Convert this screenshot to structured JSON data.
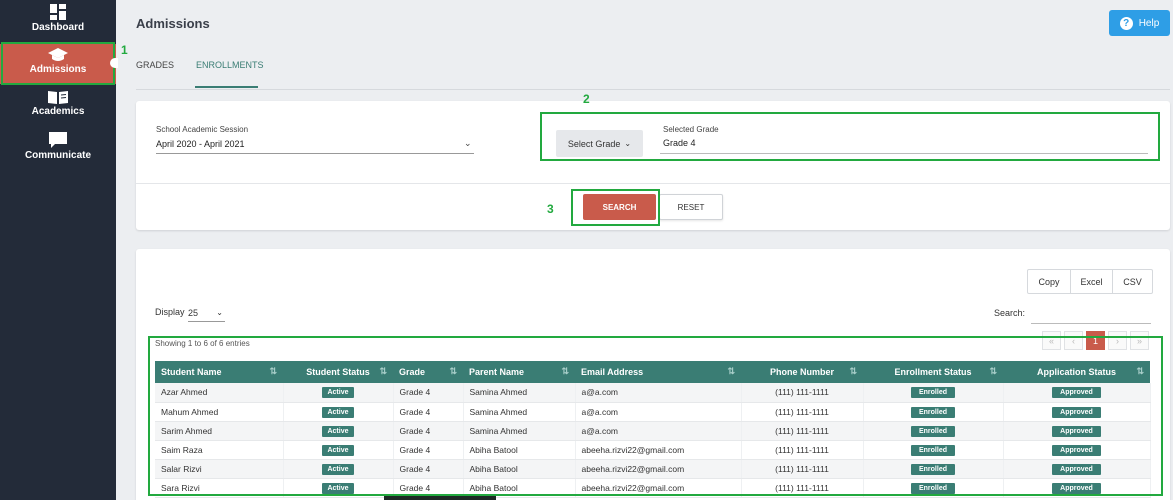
{
  "sidebar": {
    "items": [
      {
        "label": "Dashboard",
        "icon": "dashboard-icon"
      },
      {
        "label": "Admissions",
        "icon": "graduation-cap-icon"
      },
      {
        "label": "Academics",
        "icon": "book-icon"
      },
      {
        "label": "Communicate",
        "icon": "chat-bubble-icon"
      }
    ]
  },
  "annotations": {
    "a1": "1",
    "a2": "2",
    "a3": "3"
  },
  "header": {
    "title": "Admissions",
    "help_label": "Help"
  },
  "tabs": [
    {
      "label": "GRADES"
    },
    {
      "label": "ENROLLMENTS"
    }
  ],
  "filters": {
    "session_label": "School Academic Session",
    "session_value": "April 2020 - April 2021",
    "select_grade_label": "Select Grade",
    "selected_grade_label": "Selected Grade",
    "selected_grade_value": "Grade 4",
    "search_label": "SEARCH",
    "reset_label": "RESET"
  },
  "table_controls": {
    "export": [
      "Copy",
      "Excel",
      "CSV"
    ],
    "display_label": "Display",
    "display_value": "25",
    "search_label": "Search:",
    "search_value": "",
    "showing": "Showing 1 to 6 of 6 entries",
    "pager": [
      "«",
      "‹",
      "1",
      "›",
      "»"
    ]
  },
  "table": {
    "headers": [
      "Student Name",
      "Student Status",
      "Grade",
      "Parent Name",
      "Email Address",
      "Phone Number",
      "Enrollment Status",
      "Application Status"
    ],
    "rows": [
      [
        "Azar Ahmed",
        "Active",
        "Grade 4",
        "Samina Ahmed",
        "a@a.com",
        "(111) 111-1111",
        "Enrolled",
        "Approved"
      ],
      [
        "Mahum Ahmed",
        "Active",
        "Grade 4",
        "Samina Ahmed",
        "a@a.com",
        "(111) 111-1111",
        "Enrolled",
        "Approved"
      ],
      [
        "Sarim Ahmed",
        "Active",
        "Grade 4",
        "Samina Ahmed",
        "a@a.com",
        "(111) 111-1111",
        "Enrolled",
        "Approved"
      ],
      [
        "Saim Raza",
        "Active",
        "Grade 4",
        "Abiha Batool",
        "abeeha.rizvi22@gmail.com",
        "(111) 111-1111",
        "Enrolled",
        "Approved"
      ],
      [
        "Salar Rizvi",
        "Active",
        "Grade 4",
        "Abiha Batool",
        "abeeha.rizvi22@gmail.com",
        "(111) 111-1111",
        "Enrolled",
        "Approved"
      ],
      [
        "Sara Rizvi",
        "Active",
        "Grade 4",
        "Abiha Batool",
        "abeeha.rizvi22@gmail.com",
        "(111) 111-1111",
        "Enrolled",
        "Approved"
      ]
    ]
  },
  "colors": {
    "sidebar": "#232b39",
    "accent_red": "#c95b4b",
    "teal": "#3a7d74",
    "highlight_green": "#22a93f",
    "help_blue": "#2e9ee6"
  }
}
